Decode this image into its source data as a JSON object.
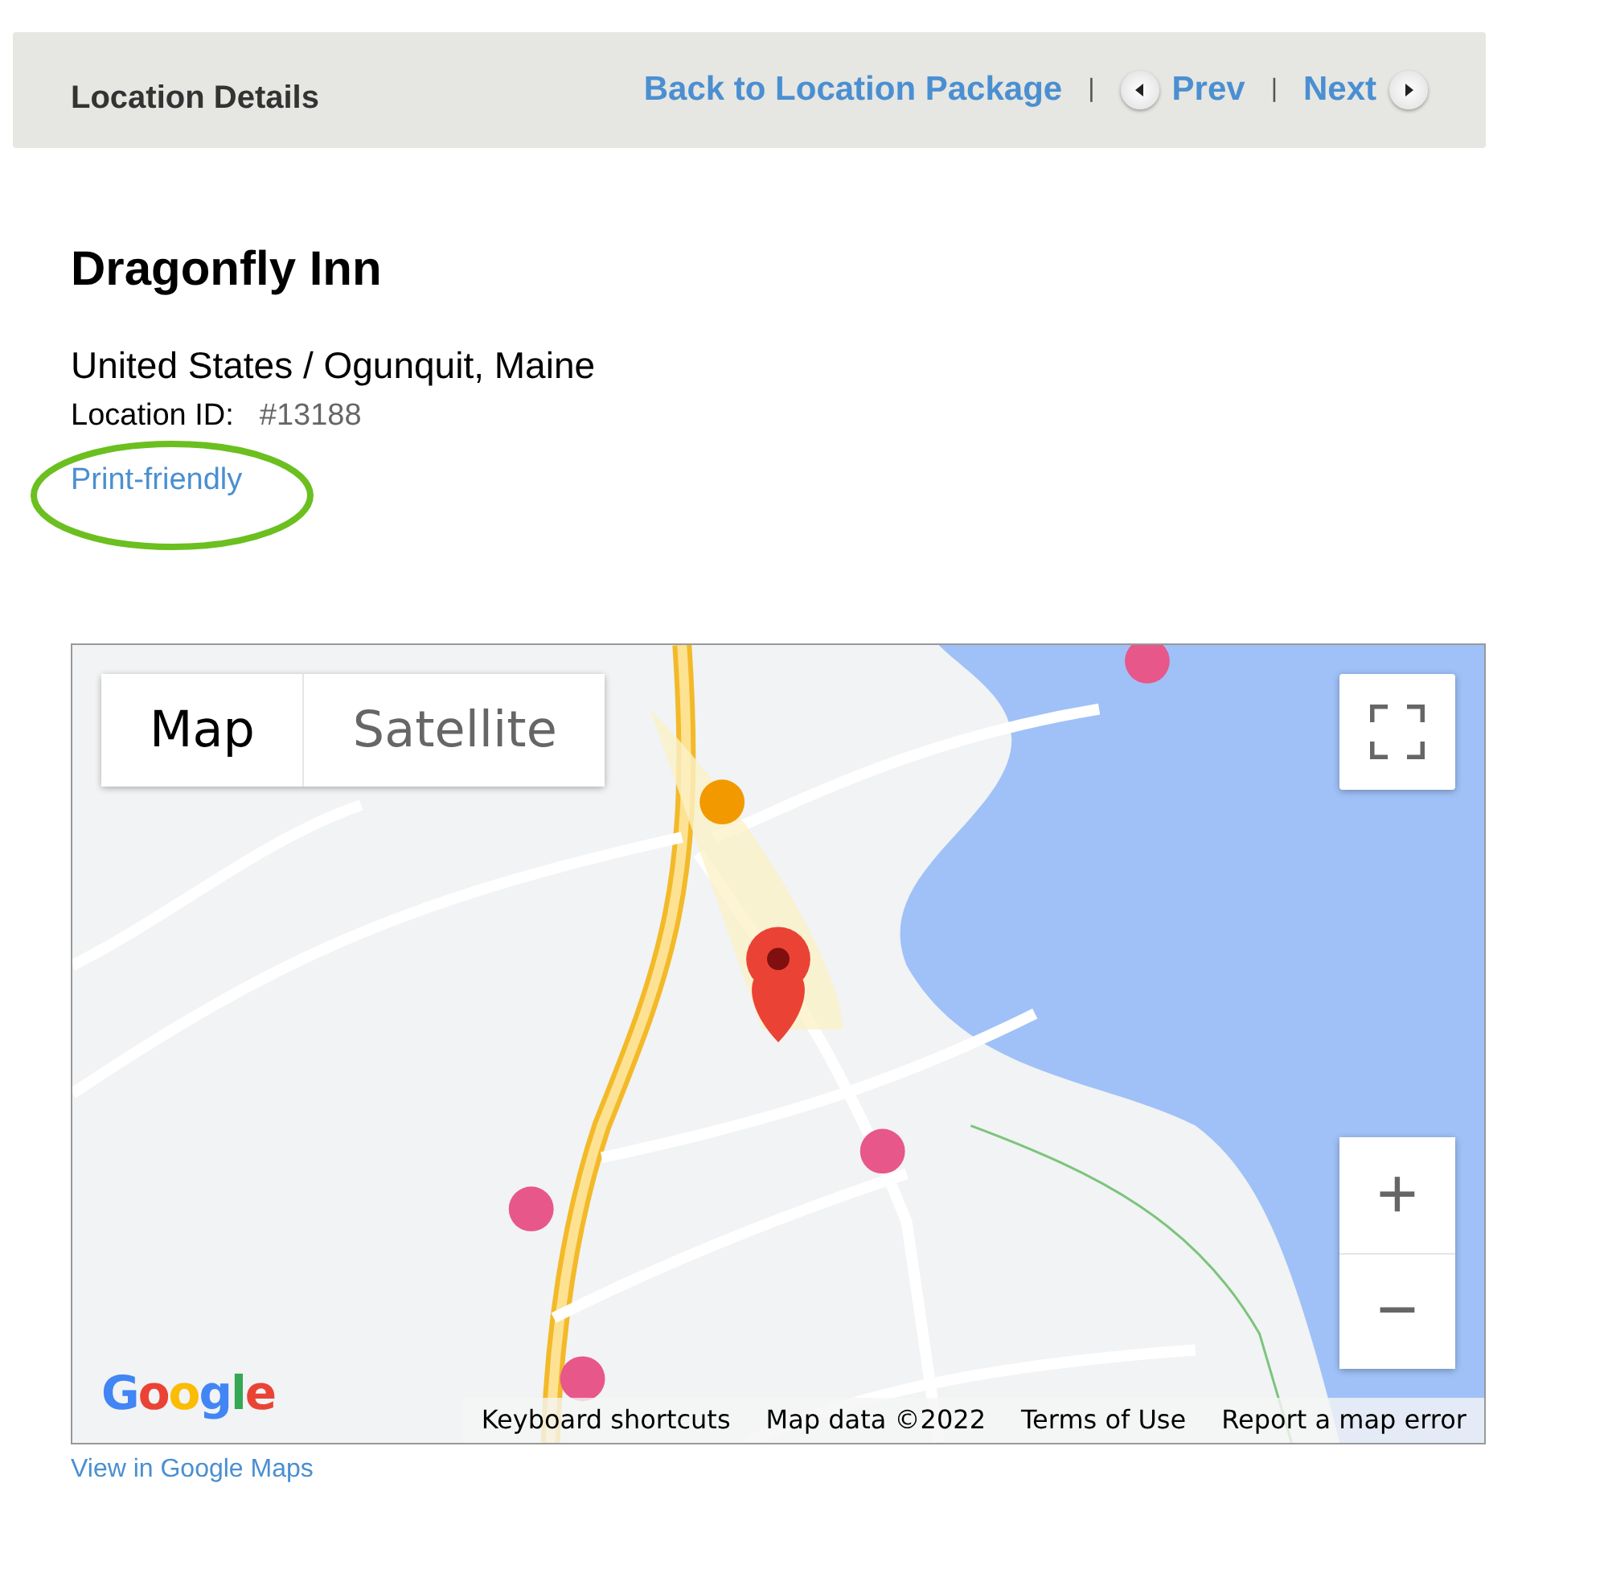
{
  "header": {
    "title": "Location Details",
    "back_link": "Back to Location Package",
    "prev": "Prev",
    "next": "Next",
    "separator": "|"
  },
  "location": {
    "name": "Dragonfly Inn",
    "region": "United States / Ogunquit, Maine",
    "id_label": "Location ID:",
    "id_value": "#13188",
    "print_link": "Print-friendly",
    "print_highlighted": true
  },
  "map": {
    "type_tabs": [
      {
        "label": "Map",
        "selected": true
      },
      {
        "label": "Satellite",
        "selected": false
      }
    ],
    "zoom_in": "+",
    "zoom_out": "−",
    "logo": "Google",
    "footer_links": [
      "Keyboard shortcuts",
      "Map data ©2022",
      "Terms of Use",
      "Report a map error"
    ]
  },
  "view_link": "View in Google Maps"
}
